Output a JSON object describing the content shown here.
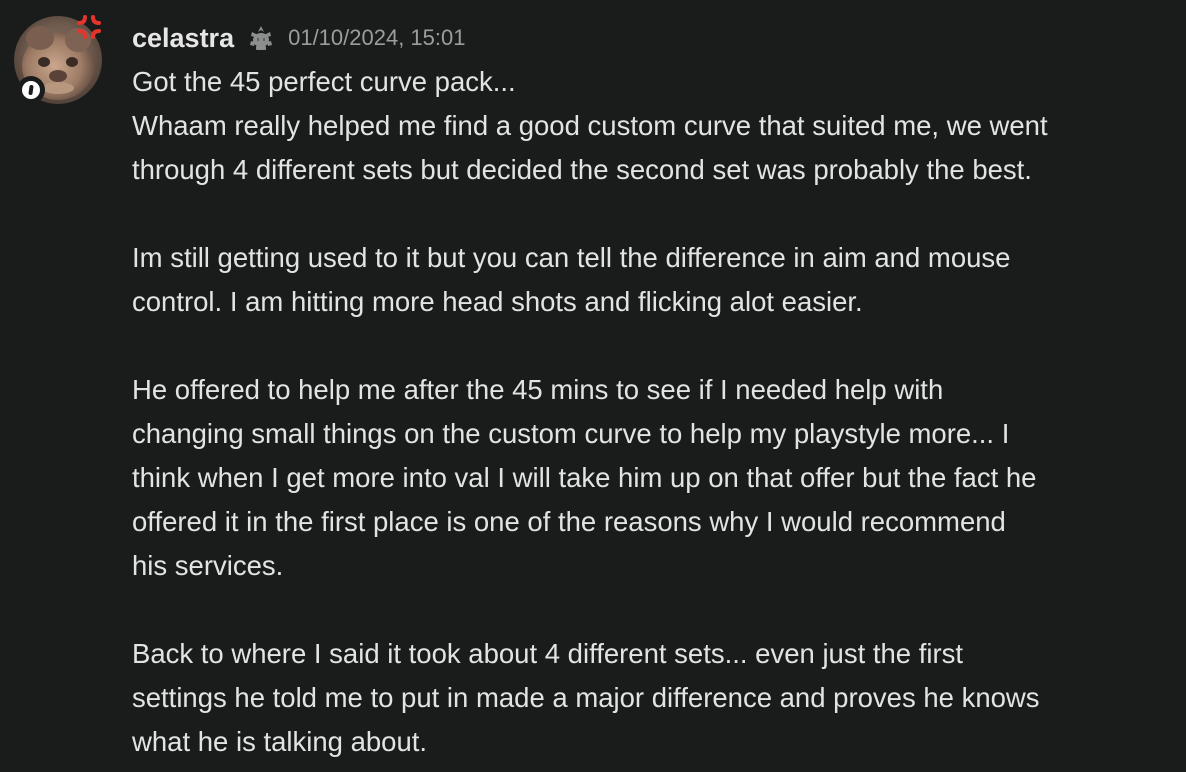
{
  "message": {
    "author": "celastra",
    "timestamp": "01/10/2024, 15:01",
    "avatar_icon": "avatar-icon",
    "decoration_icon": "anger-symbol-icon",
    "guild_tag_icon": "guild-tag-icon",
    "status_icon": "exclamation-icon",
    "colors": {
      "background": "#1a1c1b",
      "text": "#e2e3e4",
      "timestamp": "#9a9c9f",
      "decoration": "#e5352b"
    },
    "lines": [
      "Got the 45 perfect curve pack...",
      "Whaam really helped me find a good custom curve that suited me, we went",
      "through 4 different sets but decided the second set was probably the best.",
      "",
      "Im still getting used to it but you can tell the difference in aim and mouse",
      "control. I am hitting more head shots and flicking alot easier.",
      "",
      "He offered to help me after the 45 mins to see if I needed help with",
      "changing small things on the custom curve to help my playstyle more... I",
      "think when I get more into val I will take him up on that offer but the fact he",
      "offered it in the first place is one of the reasons why I would recommend",
      "his services.",
      "",
      "Back to where I said it took about 4 different sets... even just the first",
      "settings he told me to put in made a major difference and proves he knows",
      "what he is talking about."
    ]
  }
}
